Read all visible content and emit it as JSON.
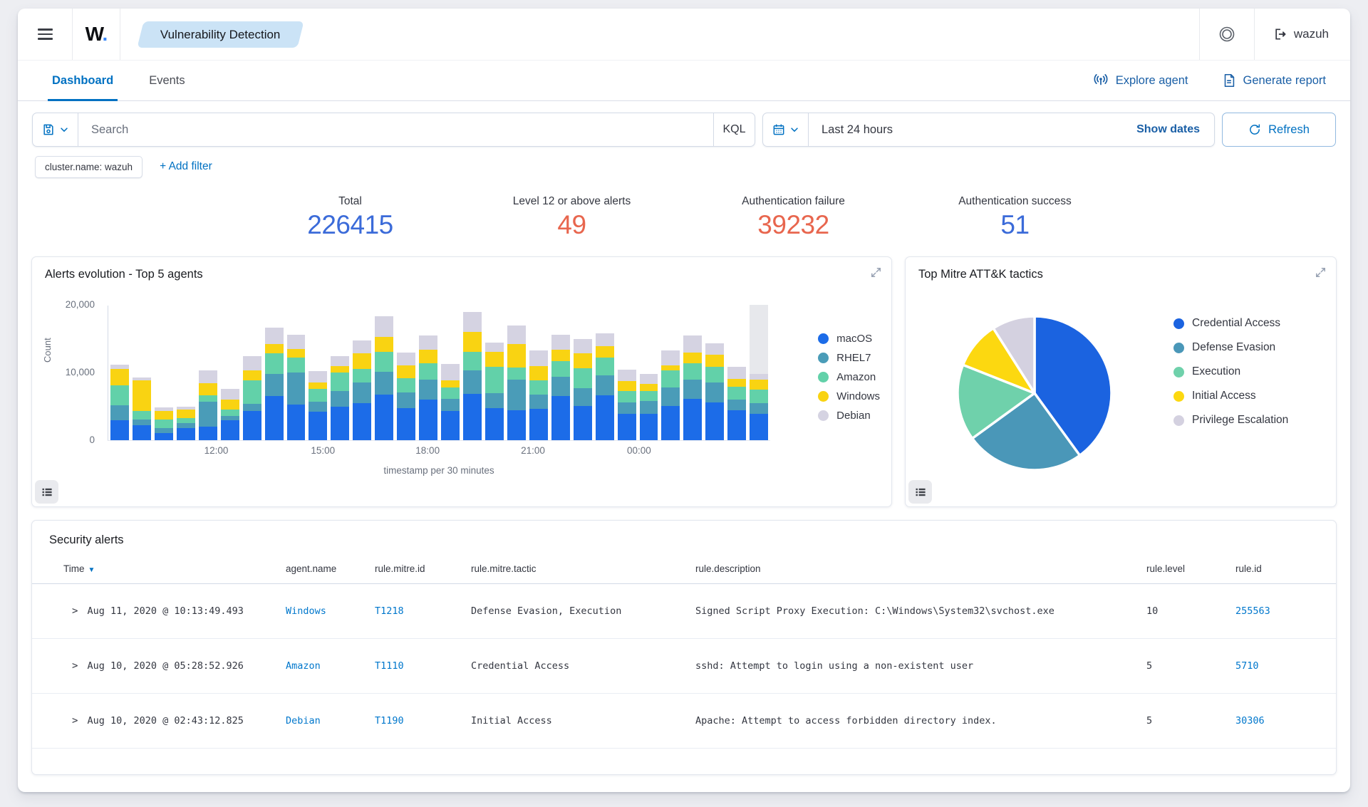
{
  "app": {
    "logo_letter": "W",
    "logo_dot": ".",
    "module_badge": "Vulnerability Detection",
    "user": "wazuh"
  },
  "tabs": [
    {
      "label": "Dashboard",
      "active": true
    },
    {
      "label": "Events",
      "active": false
    }
  ],
  "header_actions": [
    {
      "label": "Explore agent"
    },
    {
      "label": "Generate report"
    }
  ],
  "query_bar": {
    "placeholder": "Search",
    "language": "KQL",
    "time_range": "Last 24 hours",
    "show_dates_label": "Show dates",
    "refresh_label": "Refresh"
  },
  "filters": {
    "chips": [
      "cluster.name: wazuh"
    ],
    "add_filter_label": "+ Add filter"
  },
  "stats": [
    {
      "label": "Total",
      "value": "226415",
      "color": "#3b6bd9"
    },
    {
      "label": "Level 12 or above alerts",
      "value": "49",
      "color": "#e8664e"
    },
    {
      "label": "Authentication failure",
      "value": "39232",
      "color": "#e8664e"
    },
    {
      "label": "Authentication success",
      "value": "51",
      "color": "#3b6bd9"
    }
  ],
  "chart_data": [
    {
      "type": "bar",
      "stacked": true,
      "title": "Alerts evolution - Top 5 agents",
      "xlabel": "timestamp per 30 minutes",
      "ylabel": "Count",
      "ylim": [
        0,
        20000
      ],
      "yticks": [
        "0",
        "10,000",
        "20,000"
      ],
      "ytick_values": [
        0,
        10000,
        20000
      ],
      "xticks": [
        "12:00",
        "15:00",
        "18:00",
        "21:00",
        "00:00"
      ],
      "xtick_fractions": [
        0.164,
        0.325,
        0.483,
        0.642,
        0.802
      ],
      "legend_position": "right",
      "last_bucket_highlight": true,
      "series": [
        {
          "name": "macOS",
          "color": "#1c6ce8",
          "values": [
            2900,
            2200,
            1100,
            1800,
            2000,
            2900,
            4300,
            6500,
            5300,
            4200,
            5000,
            5500,
            6700,
            4700,
            6000,
            4300,
            6800,
            4700,
            4400,
            4600,
            6500,
            5100,
            6600,
            3900,
            3900,
            5100,
            6100,
            5600,
            4400,
            3900
          ]
        },
        {
          "name": "RHEL7",
          "color": "#4a9cb8",
          "values": [
            2300,
            900,
            700,
            700,
            3700,
            700,
            1100,
            3300,
            4700,
            1500,
            2300,
            3000,
            3400,
            2400,
            3000,
            1800,
            3500,
            2200,
            4500,
            2100,
            2900,
            2600,
            3000,
            1700,
            1900,
            2700,
            2900,
            2900,
            1600,
            1600
          ]
        },
        {
          "name": "Amazon",
          "color": "#62d1a9",
          "values": [
            2900,
            1200,
            1300,
            800,
            900,
            900,
            3400,
            3000,
            2200,
            1900,
            2700,
            2000,
            3000,
            2100,
            2400,
            1700,
            2800,
            3900,
            1800,
            2100,
            2300,
            2900,
            2600,
            1700,
            1500,
            2500,
            2400,
            2300,
            1900,
            2000
          ]
        },
        {
          "name": "Windows",
          "color": "#f9d312",
          "values": [
            2400,
            4500,
            1200,
            1200,
            1800,
            1500,
            1500,
            1400,
            1300,
            900,
            1000,
            2300,
            2200,
            1900,
            2000,
            1000,
            2900,
            2300,
            3500,
            2200,
            1700,
            2200,
            1700,
            1400,
            1000,
            800,
            1600,
            1800,
            1200,
            1400
          ]
        },
        {
          "name": "Debian",
          "color": "#d5d3e2",
          "values": [
            700,
            500,
            600,
            500,
            1900,
            1600,
            2100,
            2400,
            2100,
            1700,
            1400,
            1900,
            3000,
            1900,
            2100,
            2500,
            2900,
            1300,
            2700,
            2300,
            2200,
            2200,
            1900,
            1700,
            1500,
            2200,
            2500,
            1700,
            1700,
            900
          ]
        }
      ]
    },
    {
      "type": "pie",
      "title": "Top Mitre ATT&K tactics",
      "labels": [
        "Credential Access",
        "Defense Evasion",
        "Execution",
        "Initial Access",
        "Privilege Escalation"
      ],
      "values": [
        40,
        25,
        16,
        10,
        9
      ],
      "colors": [
        "#1b63e0",
        "#4a97b8",
        "#6fd1ab",
        "#fcd810",
        "#d4d1e0"
      ],
      "legend_position": "right"
    }
  ],
  "table": {
    "title": "Security alerts",
    "columns": [
      "Time",
      "agent.name",
      "rule.mitre.id",
      "rule.mitre.tactic",
      "rule.description",
      "rule.level",
      "rule.id"
    ],
    "rows": [
      {
        "time": "Aug 11, 2020 @ 10:13:49.493",
        "agent": "Windows",
        "mitre_id": "T1218",
        "tactic": "Defense Evasion, Execution",
        "description": "Signed Script Proxy Execution: C:\\Windows\\System32\\svchost.exe",
        "level": "10",
        "rule_id": "255563"
      },
      {
        "time": "Aug 10, 2020 @ 05:28:52.926",
        "agent": "Amazon",
        "mitre_id": "T1110",
        "tactic": "Credential Access",
        "description": "sshd: Attempt to login using a non-existent user",
        "level": "5",
        "rule_id": "5710"
      },
      {
        "time": "Aug 10, 2020 @ 02:43:12.825",
        "agent": "Debian",
        "mitre_id": "T1190",
        "tactic": "Initial Access",
        "description": "Apache: Attempt to access forbidden directory index.",
        "level": "5",
        "rule_id": "30306"
      }
    ]
  },
  "colors": {
    "primary_link": "#0071c2",
    "nav_action_blue": "#1a5fa6",
    "stat_blue": "#3b6bd9",
    "stat_orange": "#e8664e",
    "badge_bg": "#cbe3f6",
    "border": "#d3dae6"
  }
}
